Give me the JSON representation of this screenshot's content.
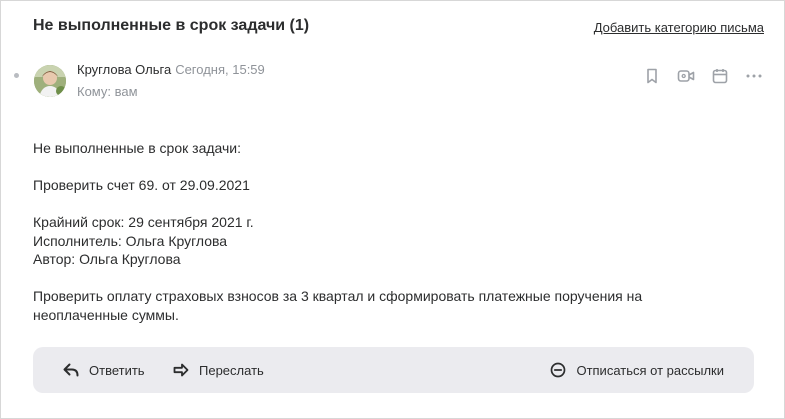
{
  "header": {
    "subject": "Не выполненные в срок задачи (1)",
    "add_category_label": "Добавить категорию письма"
  },
  "message": {
    "sender_name": "Круглова Ольга",
    "date": "Сегодня, 15:59",
    "to_label": "Кому: вам",
    "toolbar_icons": [
      "bookmark-icon",
      "video-icon",
      "calendar-icon",
      "more-icon"
    ],
    "body_lines": [
      "Не выполненные в срок задачи:",
      "",
      "Проверить счет 69. от 29.09.2021",
      "",
      "Крайний срок: 29 сентября 2021 г.",
      "Исполнитель: Ольга Круглова",
      "Автор: Ольга Круглова",
      "",
      "Проверить оплату страховых взносов за 3 квартал и сформировать платежные поручения на",
      "неоплаченные суммы."
    ]
  },
  "footer": {
    "reply_label": "Ответить",
    "forward_label": "Переслать",
    "unsubscribe_label": "Отписаться от рассылки"
  },
  "colors": {
    "text": "#2c2d2e",
    "muted": "#8f9399",
    "bar_bg": "#ebebef",
    "icon": "#9ea2a8"
  }
}
